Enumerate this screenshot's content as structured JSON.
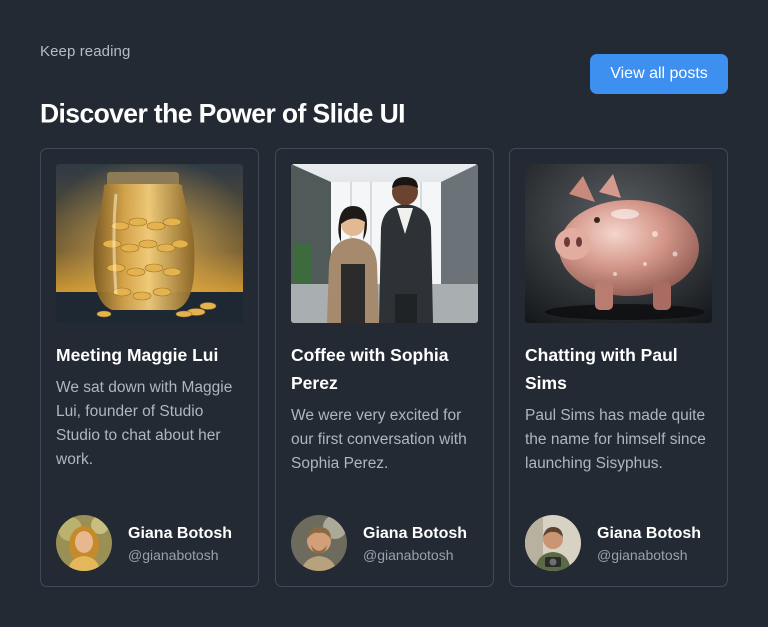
{
  "header": {
    "eyebrow": "Keep reading",
    "title": "Discover the Power of Slide UI",
    "view_all_label": "View all posts"
  },
  "posts": [
    {
      "image": "jar-of-gold-coins",
      "title": "Meeting Maggie Lui",
      "excerpt": "We sat down with Maggie Lui, founder of Studio Studio to chat about her work.",
      "author": {
        "name": "Giana Botosh",
        "handle": "@gianabotosh"
      }
    },
    {
      "image": "two-business-people-in-office",
      "title": "Coffee with Sophia Perez",
      "excerpt": "We were very excited for our first conversation with Sophia Perez.",
      "author": {
        "name": "Giana Botosh",
        "handle": "@gianabotosh"
      }
    },
    {
      "image": "glass-piggy-bank",
      "title": "Chatting with Paul Sims",
      "excerpt": "Paul Sims has made quite the name for himself since launching Sisyphus.",
      "author": {
        "name": "Giana Botosh",
        "handle": "@gianabotosh"
      }
    }
  ],
  "colors": {
    "background": "#232a33",
    "card_border": "#414b57",
    "accent": "#3d8ff0",
    "muted_text": "#aeb6c0"
  }
}
